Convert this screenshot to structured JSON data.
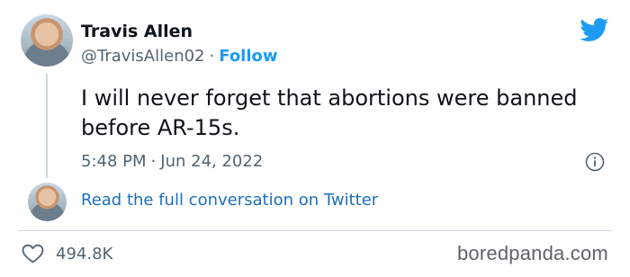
{
  "tweet": {
    "author_name": "Travis Allen",
    "handle": "@TravisAllen02",
    "separator": "·",
    "follow_label": "Follow",
    "text": "I will never forget that abortions were banned before AR-15s.",
    "time": "5:48 PM",
    "date": "Jun 24, 2022",
    "read_more_label": "Read the full conversation on Twitter",
    "likes": "494.8K"
  },
  "watermark": "boredpanda.com",
  "colors": {
    "twitter_blue": "#1d9bf0",
    "link_blue": "#1d6fb8",
    "secondary_text": "#536471",
    "primary_text": "#0f1419"
  },
  "icons": [
    "twitter-bird-icon",
    "info-icon",
    "heart-icon"
  ]
}
